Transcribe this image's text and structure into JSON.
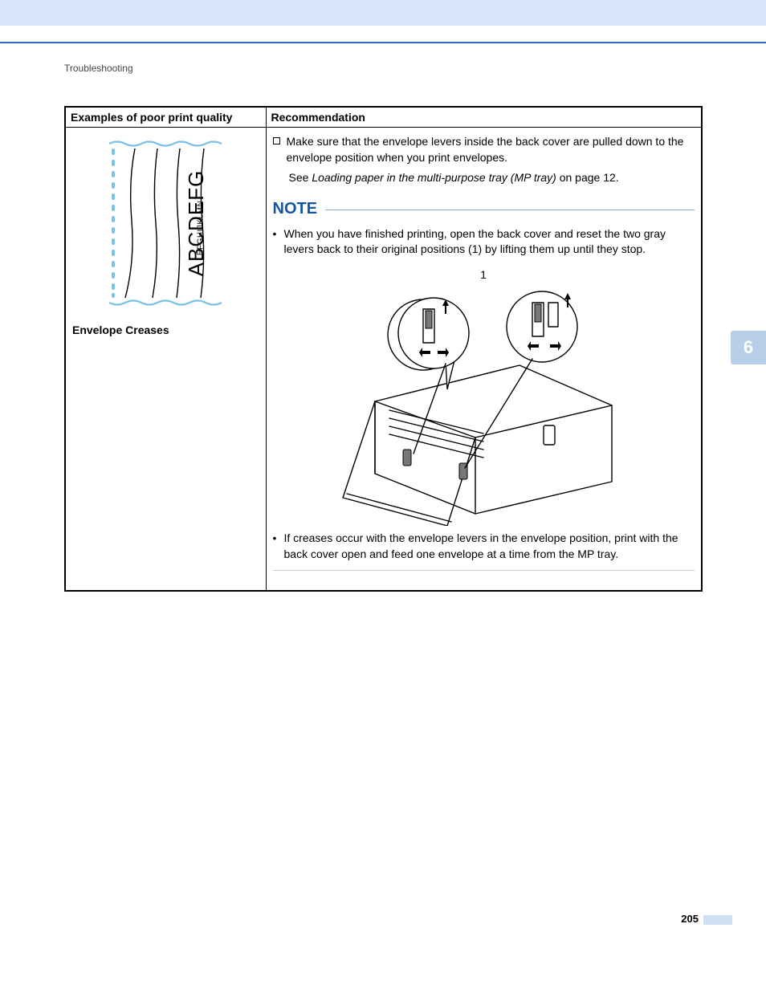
{
  "header": {
    "section": "Troubleshooting"
  },
  "table": {
    "headers": {
      "left": "Examples of poor print quality",
      "right": "Recommendation"
    },
    "envelope": {
      "large": "ABCDEFG",
      "small": "EFGHIJKLMN",
      "caption": "Envelope Creases"
    },
    "rec": {
      "bullet1": "Make sure that the envelope levers inside the back cover are pulled down to the envelope position when you print envelopes.",
      "see_prefix": "See ",
      "see_italic": "Loading paper in the multi-purpose tray (MP tray)",
      "see_suffix": " on page 12.",
      "note_label": "NOTE",
      "note1": "When you have finished printing, open the back cover and reset the two gray levers back to their original positions (1) by lifting them up until they stop.",
      "diagram_label": "1",
      "note2": "If creases occur with the envelope levers in the envelope position, print with the back cover open and feed one envelope at a time from the MP tray."
    }
  },
  "sideTab": "6",
  "pageNumber": "205"
}
